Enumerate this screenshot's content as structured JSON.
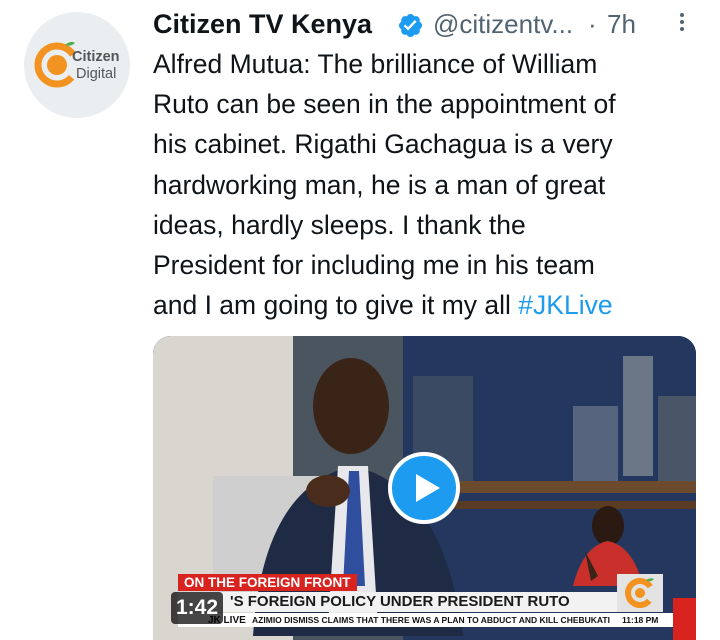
{
  "tweet": {
    "author_name": "Citizen TV Kenya",
    "handle": "@citizentv...",
    "separator": "·",
    "time": "7h",
    "avatar_text": [
      "Citizen",
      "Digital"
    ],
    "text_lines": [
      "Alfred Mutua: The brilliance of William",
      "Ruto can be seen in the appointment of",
      "his cabinet. Rigathi Gachagua is a very",
      "hardworking man, he is a man of great",
      "ideas, hardly sleeps. I thank the",
      "President for including me in his team",
      "and I am going to give it my all "
    ],
    "hashtag": "#JKLive"
  },
  "video": {
    "duration": "1:42",
    "lower_third_tag": "ON THE FOREIGN FRONT",
    "lower_third_headline": "'S FOREIGN POLICY UNDER PRESIDENT RUTO",
    "ticker_tag": "JK LIVE",
    "ticker_text": "AZIMIO DISMISS CLAIMS THAT THERE WAS A PLAN TO ABDUCT AND KILL CHEBUKATI",
    "ticker_time": "11:18 PM"
  },
  "colors": {
    "accent": "#1d9bf0",
    "brand_orange": "#f29221",
    "brand_green": "#4caf50",
    "news_red": "#d8231f"
  },
  "icons": {
    "verified": "verified-badge-icon",
    "more": "more-vertical-icon",
    "play": "play-icon"
  }
}
